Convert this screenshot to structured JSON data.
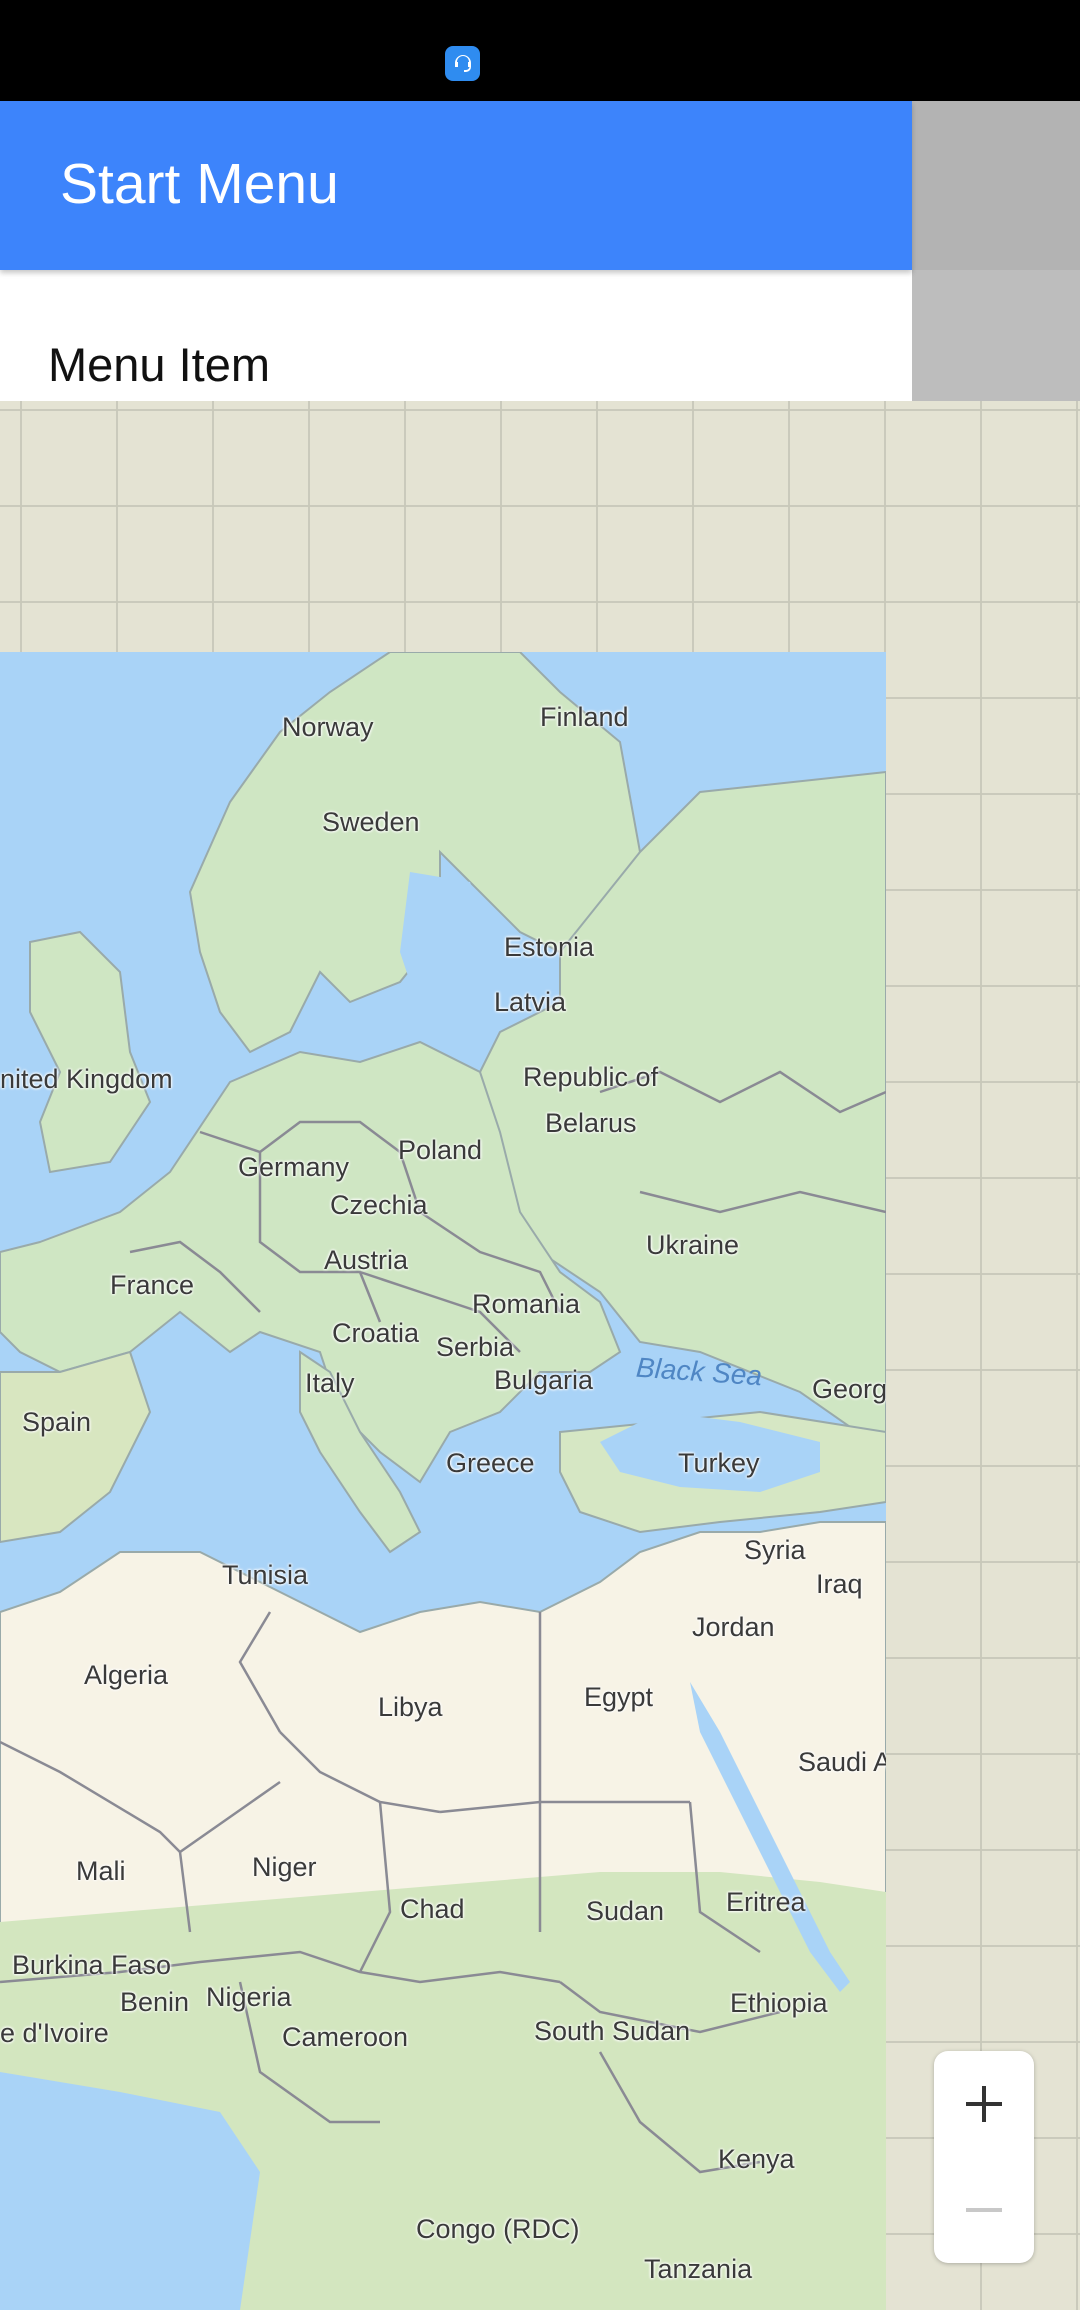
{
  "status_bar": {
    "app_icon": "support-agent-icon"
  },
  "drawer": {
    "title": "Start Menu",
    "items": [
      {
        "label": "Menu Item"
      }
    ]
  },
  "map": {
    "labels": {
      "norway": "Norway",
      "finland": "Finland",
      "sweden": "Sweden",
      "estonia": "Estonia",
      "latvia": "Latvia",
      "united_kingdom": "nited Kingdom",
      "republic_of": "Republic of",
      "belarus": "Belarus",
      "poland": "Poland",
      "germany": "Germany",
      "czechia": "Czechia",
      "ukraine": "Ukraine",
      "austria": "Austria",
      "france": "France",
      "romania": "Romania",
      "croatia": "Croatia",
      "serbia": "Serbia",
      "black_sea": "Black Sea",
      "italy": "Italy",
      "bulgaria": "Bulgaria",
      "georgia": "Georgia",
      "spain": "Spain",
      "greece": "Greece",
      "turkey": "Turkey",
      "syria": "Syria",
      "tunisia": "Tunisia",
      "iraq": "Iraq",
      "jordan": "Jordan",
      "algeria": "Algeria",
      "egypt": "Egypt",
      "libya": "Libya",
      "saudi_arabia": "Saudi Arabia",
      "mali": "Mali",
      "niger": "Niger",
      "chad": "Chad",
      "sudan": "Sudan",
      "eritrea": "Eritrea",
      "burkina_faso": "Burkina Faso",
      "benin": "Benin",
      "nigeria": "Nigeria",
      "ethiopia": "Ethiopia",
      "cote_divoire": "e d'Ivoire",
      "cameroon": "Cameroon",
      "south_sudan": "South Sudan",
      "kenya": "Kenya",
      "congo": "Congo (RDC)",
      "tanzania": "Tanzania"
    },
    "colors": {
      "water": "#a9d3f7",
      "land": "#cfe6c3",
      "desert": "#f7f3e6",
      "border": "#8a8a94"
    }
  },
  "zoom": {
    "in_icon": "plus-icon",
    "out_icon": "minus-icon"
  },
  "colors": {
    "header": "#3d84fb",
    "scrim": "#bdbdbd",
    "background": "#e4e3d3"
  }
}
